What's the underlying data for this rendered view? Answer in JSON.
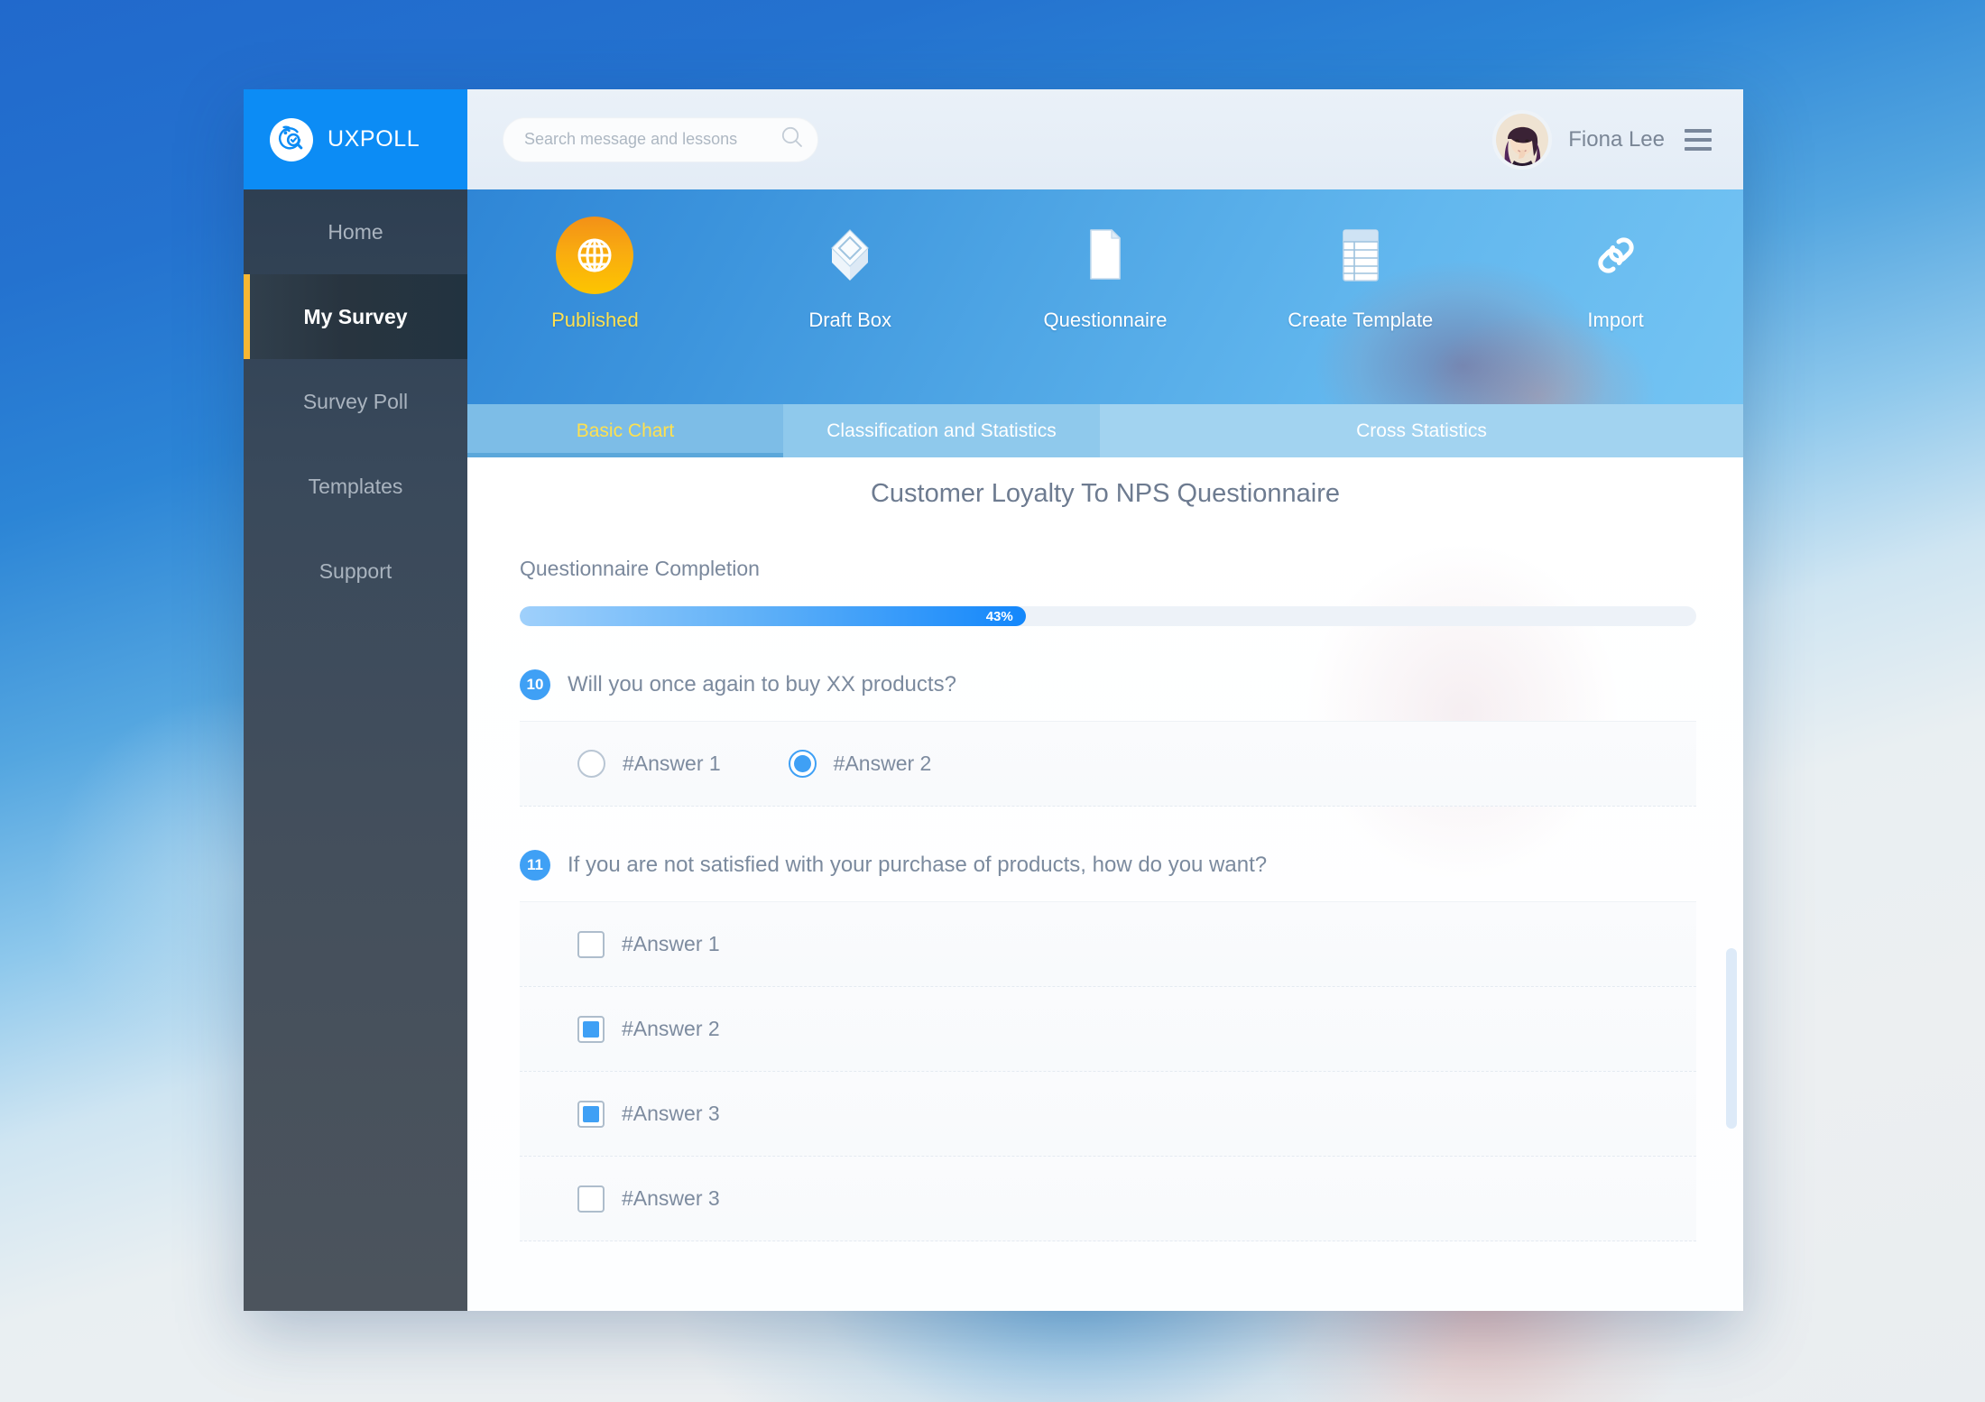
{
  "brand": {
    "name": "UXPOLL",
    "logo_icon": "radar-search-check-icon"
  },
  "search": {
    "placeholder": "Search message and lessons",
    "value": "",
    "icon": "search-icon"
  },
  "user": {
    "name": "Fiona Lee",
    "avatar_icon": "avatar",
    "menu_icon": "hamburger-menu-icon"
  },
  "sidebar": {
    "items": [
      {
        "label": "Home",
        "active": false
      },
      {
        "label": "My Survey",
        "active": true
      },
      {
        "label": "Survey Poll",
        "active": false
      },
      {
        "label": "Templates",
        "active": false
      },
      {
        "label": "Support",
        "active": false
      }
    ]
  },
  "iconbar": {
    "items": [
      {
        "label": "Published",
        "icon": "globe-icon",
        "active": true
      },
      {
        "label": "Draft Box",
        "icon": "box-icon",
        "active": false
      },
      {
        "label": "Questionnaire",
        "icon": "document-icon",
        "active": false
      },
      {
        "label": "Create Template",
        "icon": "table-icon",
        "active": false
      },
      {
        "label": "Import",
        "icon": "link-icon",
        "active": false
      }
    ]
  },
  "tabs": [
    {
      "label": "Basic Chart",
      "active": true
    },
    {
      "label": "Classification and Statistics",
      "active": false
    },
    {
      "label": "Cross Statistics",
      "active": false
    }
  ],
  "main": {
    "title": "Customer Loyalty To NPS Questionnaire",
    "completion_label": "Questionnaire Completion",
    "completion_percent": "43%",
    "completion_value": 43
  },
  "questions": [
    {
      "number": "10",
      "text": "Will you once again to buy XX products?",
      "type": "radio",
      "options": [
        {
          "label": "#Answer 1",
          "selected": false
        },
        {
          "label": "#Answer 2",
          "selected": true
        }
      ]
    },
    {
      "number": "11",
      "text": "If you are not satisfied with your purchase of products, how do you want?",
      "type": "checkbox",
      "options": [
        {
          "label": "#Answer 1",
          "selected": false
        },
        {
          "label": "#Answer 2",
          "selected": true
        },
        {
          "label": "#Answer 3",
          "selected": true
        },
        {
          "label": "#Answer 3",
          "selected": false
        }
      ]
    }
  ],
  "colors": {
    "brand_blue": "#0c8cf5",
    "accent_yellow": "#ffe14f",
    "sidebar_marker": "#f7b733",
    "progress_blue": "#1387fb",
    "published_orange": "#f9ab10"
  }
}
